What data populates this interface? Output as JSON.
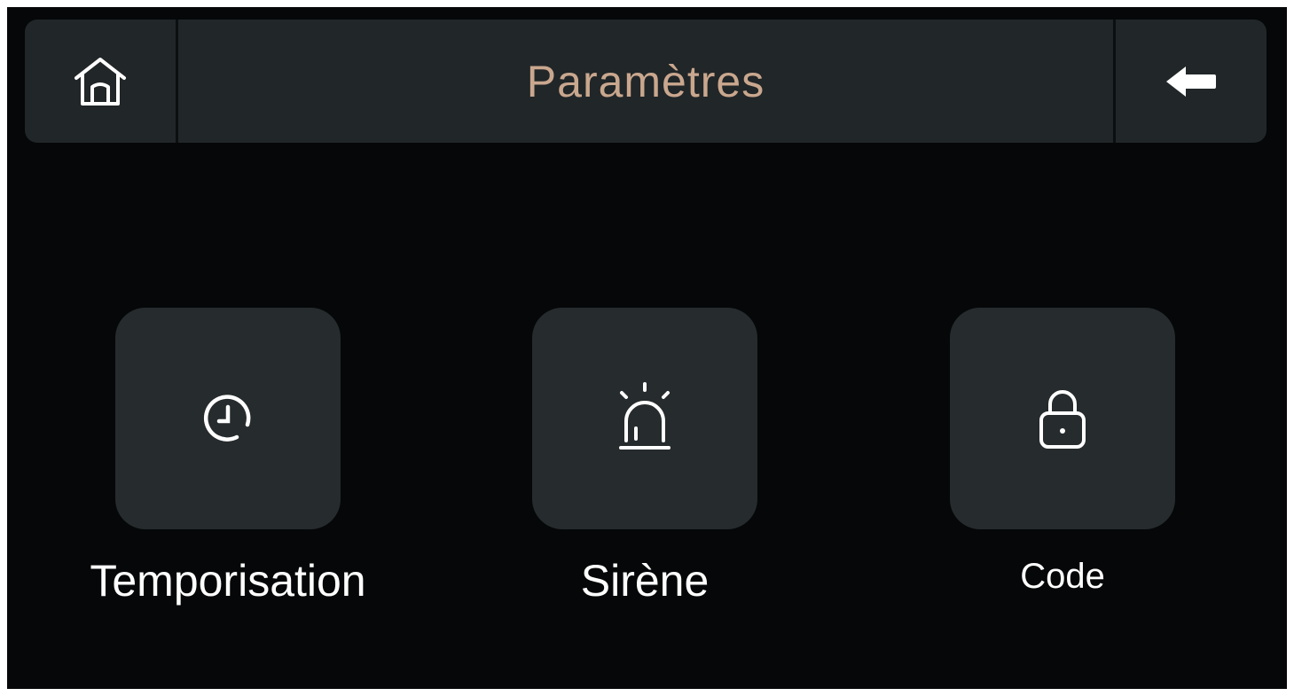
{
  "header": {
    "title": "Paramètres",
    "home_icon": "home-icon",
    "back_icon": "arrow-left-icon"
  },
  "menu": {
    "items": [
      {
        "label": "Temporisation",
        "icon": "timer-icon"
      },
      {
        "label": "Sirène",
        "icon": "siren-icon"
      },
      {
        "label": "Code",
        "icon": "lock-icon"
      }
    ]
  },
  "colors": {
    "background": "#050708",
    "panel": "#212628",
    "tile": "#262b2d",
    "title_accent": "#c9a78e",
    "text": "#ffffff"
  }
}
